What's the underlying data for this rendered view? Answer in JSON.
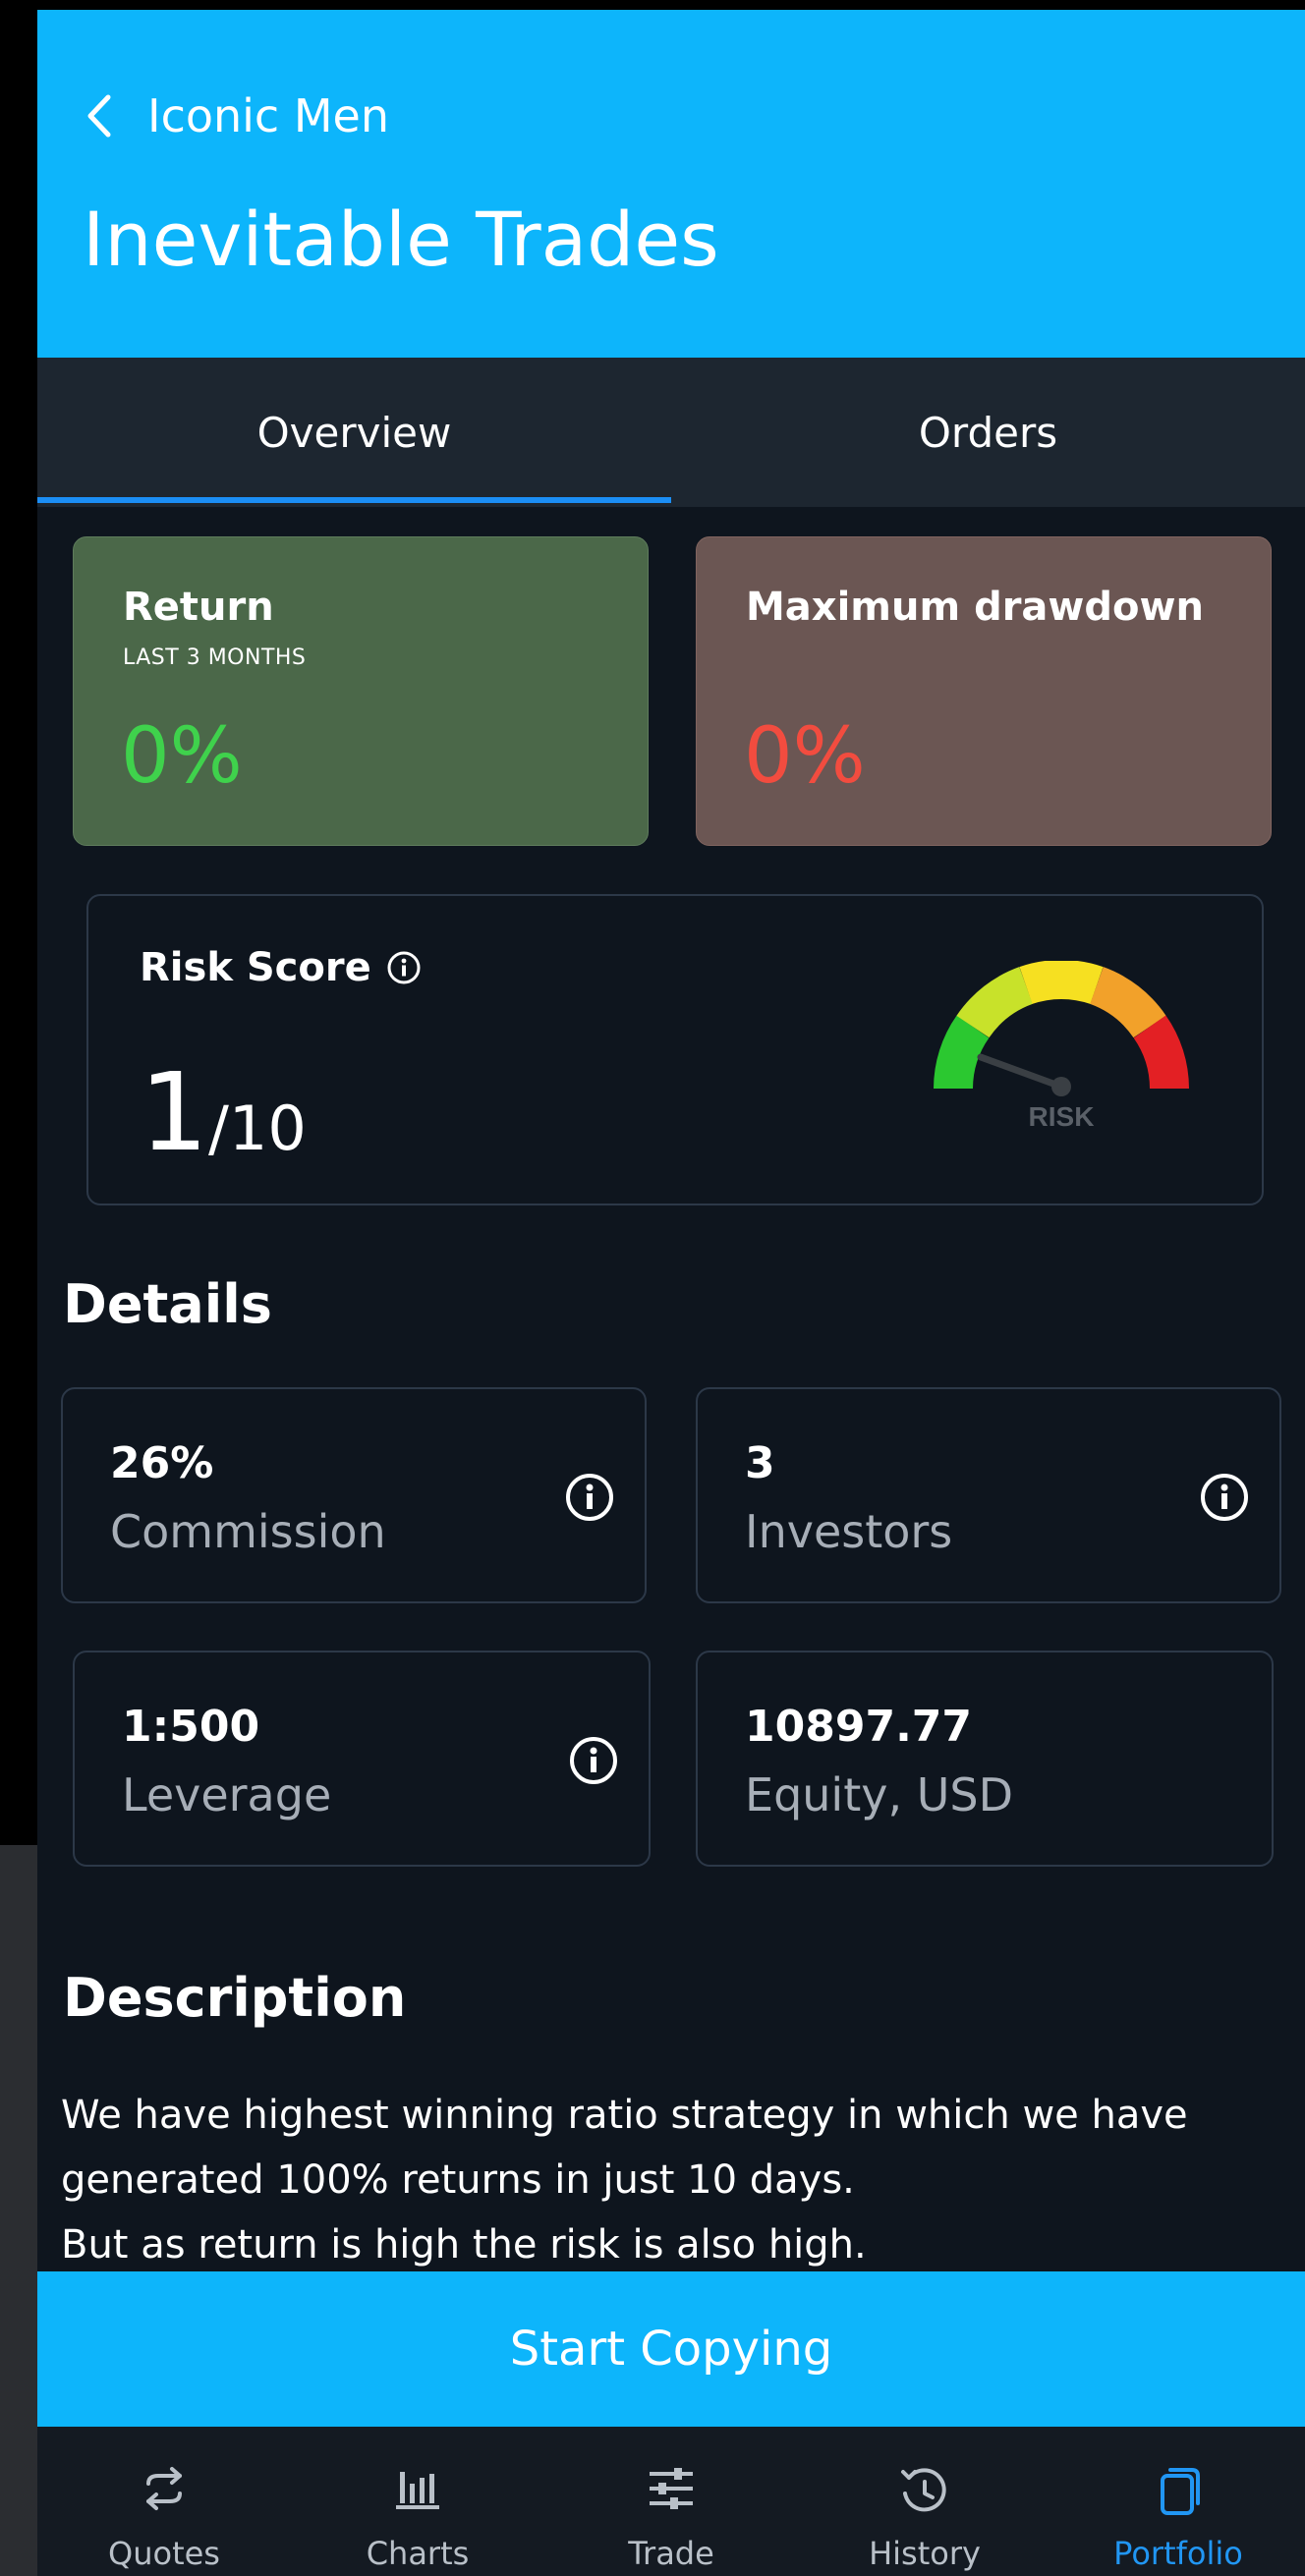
{
  "header": {
    "back_label": "Iconic Men",
    "title": "Inevitable Trades"
  },
  "tabs": [
    {
      "label": "Overview",
      "active": true
    },
    {
      "label": "Orders",
      "active": false
    }
  ],
  "stats": {
    "return": {
      "title": "Return",
      "subtitle": "LAST 3 MONTHS",
      "value": "0%"
    },
    "drawdown": {
      "title": "Maximum drawdown",
      "value": "0%"
    }
  },
  "risk": {
    "title": "Risk Score",
    "score": "1",
    "max": "/10",
    "gauge_label": "RISK"
  },
  "details": {
    "title": "Details",
    "items": [
      {
        "value": "26%",
        "label": "Commission",
        "has_info": true
      },
      {
        "value": "3",
        "label": "Investors",
        "has_info": true
      },
      {
        "value": "1:500",
        "label": "Leverage",
        "has_info": true
      },
      {
        "value": "10897.77",
        "label": "Equity, USD",
        "has_info": false
      }
    ]
  },
  "description": {
    "title": "Description",
    "lines": [
      "We have highest winning ratio strategy in which we have",
      "generated 100% returns in just 10 days.",
      "But as return is high the risk is also high."
    ]
  },
  "cta": {
    "label": "Start Copying"
  },
  "nav": [
    {
      "label": "Quotes",
      "icon": "swap-arrows-icon"
    },
    {
      "label": "Charts",
      "icon": "bar-chart-icon"
    },
    {
      "label": "Trade",
      "icon": "sliders-icon"
    },
    {
      "label": "History",
      "icon": "history-icon"
    },
    {
      "label": "Portfolio",
      "icon": "portfolio-icon",
      "active": true
    }
  ],
  "colors": {
    "header": "#0db5fb",
    "background": "#0e151e",
    "return_card": "#4b6849",
    "drawdown_card": "#6b5653",
    "positive": "#3fd24c",
    "negative": "#f24c3f",
    "nav_active": "#2196f3"
  }
}
